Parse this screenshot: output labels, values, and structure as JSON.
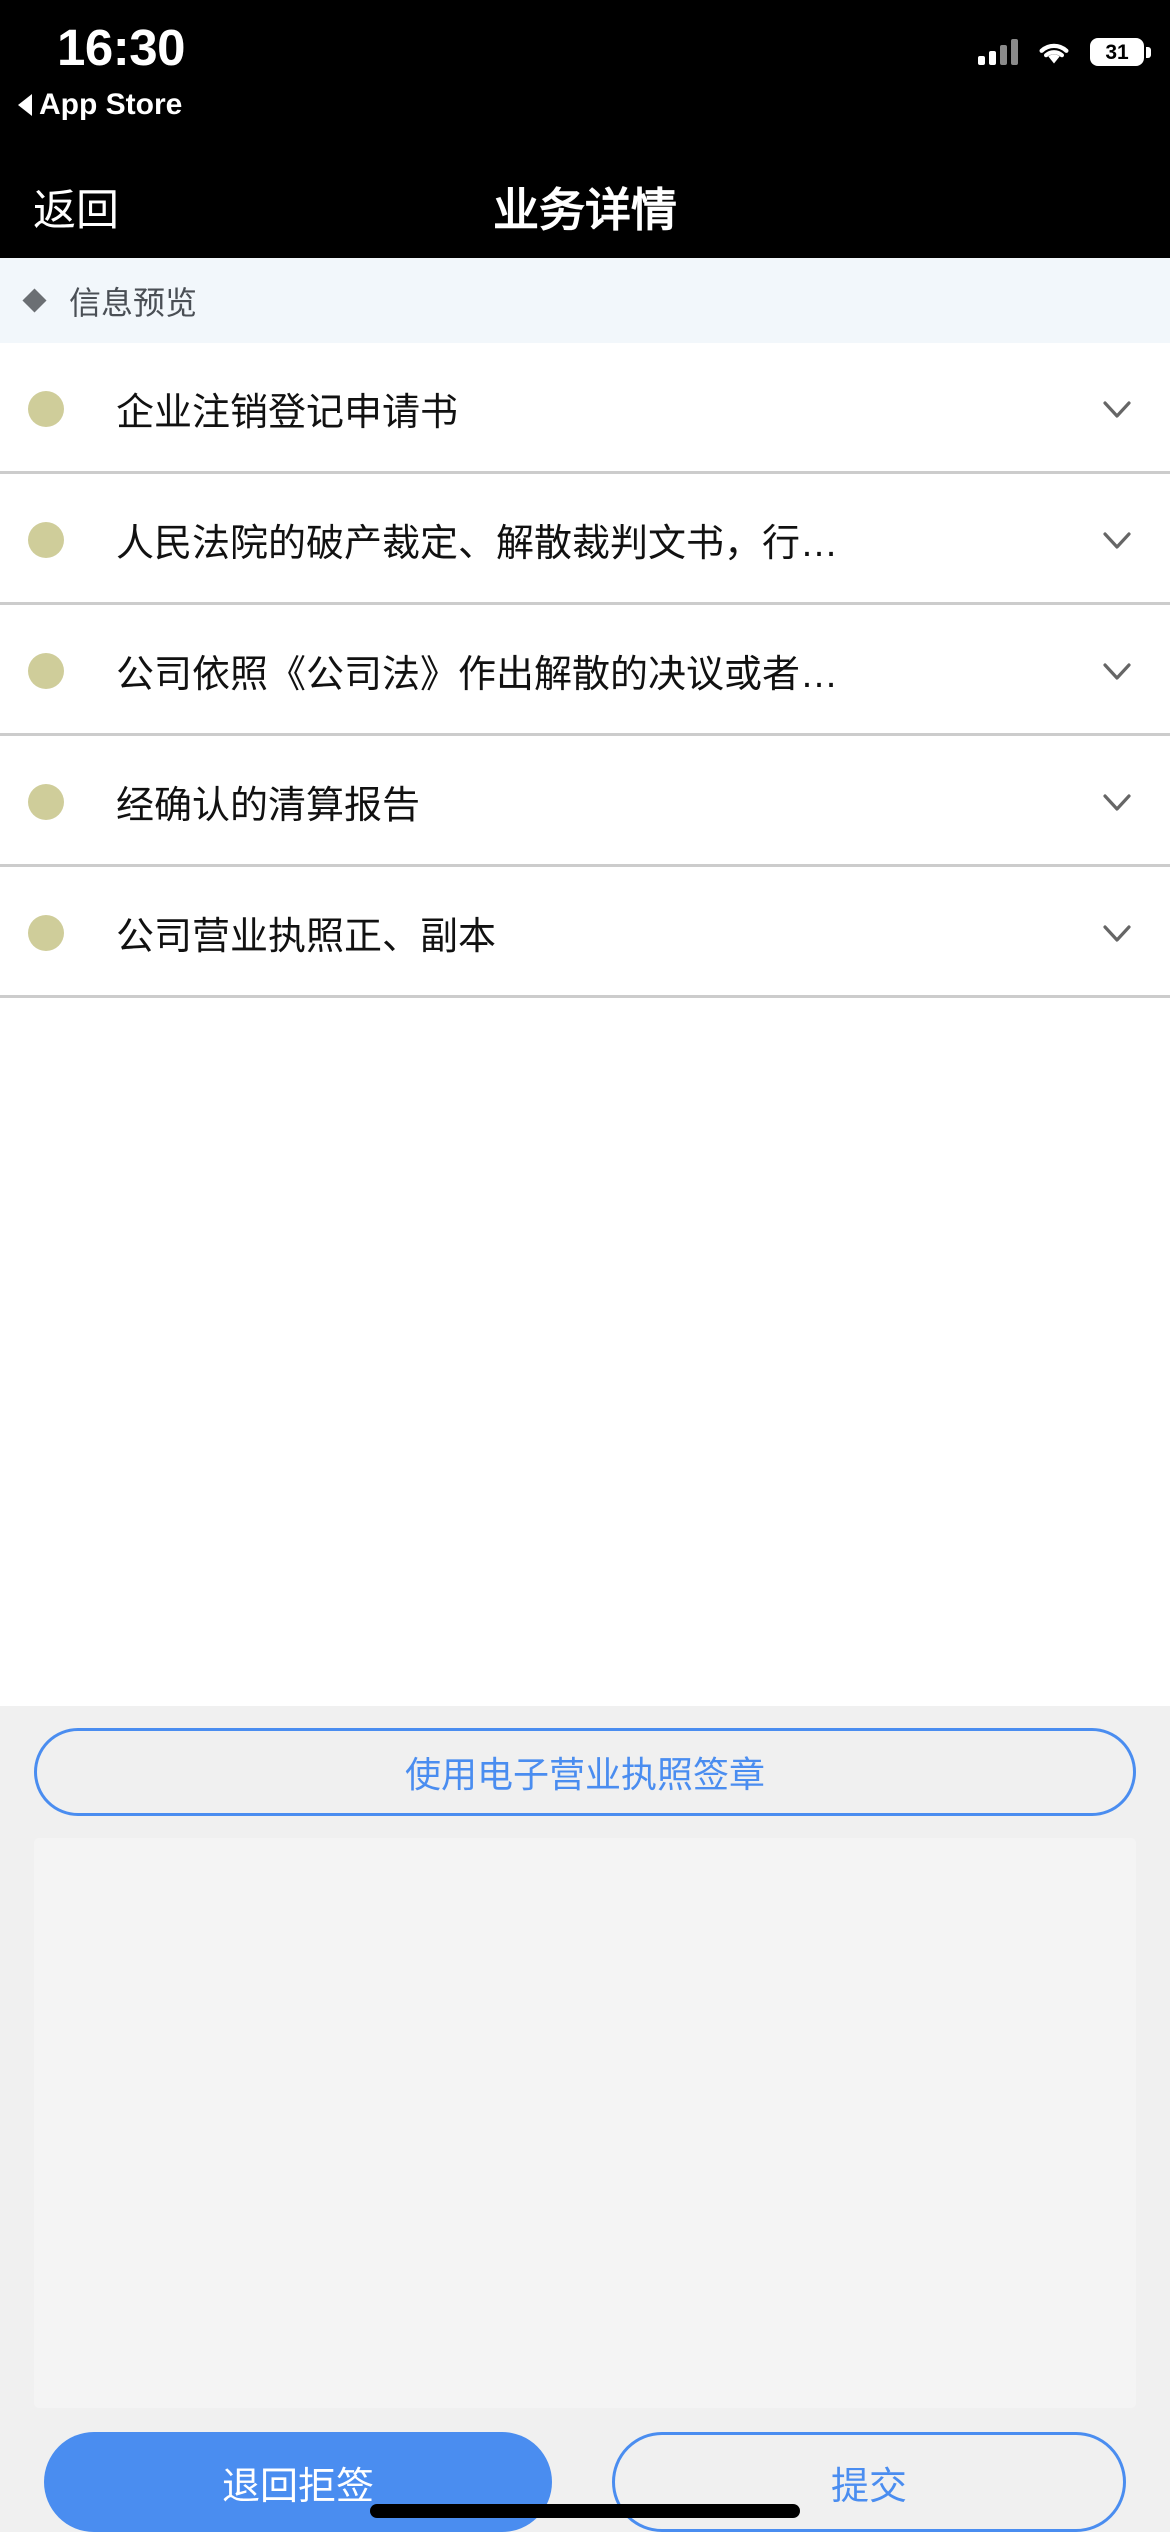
{
  "status_bar": {
    "time": "16:30",
    "back_to_app": "App Store",
    "battery_level": "31",
    "icons": {
      "back_triangle": "triangle-left-icon",
      "cellular": "cellular-bars-icon",
      "wifi": "wifi-icon",
      "battery": "battery-icon"
    }
  },
  "nav_bar": {
    "back_label": "返回",
    "title": "业务详情"
  },
  "section": {
    "bullet_icon": "diamond-bullet-icon",
    "title": "信息预览"
  },
  "list": {
    "items": [
      {
        "label": "企业注销登记申请书",
        "bullet_icon": "status-dot-icon",
        "chevron_icon": "chevron-down-icon"
      },
      {
        "label": "人民法院的破产裁定、解散裁判文书，行…",
        "bullet_icon": "status-dot-icon",
        "chevron_icon": "chevron-down-icon"
      },
      {
        "label": "公司依照《公司法》作出解散的决议或者…",
        "bullet_icon": "status-dot-icon",
        "chevron_icon": "chevron-down-icon"
      },
      {
        "label": "经确认的清算报告",
        "bullet_icon": "status-dot-icon",
        "chevron_icon": "chevron-down-icon"
      },
      {
        "label": "公司营业执照正、副本",
        "bullet_icon": "status-dot-icon",
        "chevron_icon": "chevron-down-icon"
      }
    ]
  },
  "bottom": {
    "seal_button_label": "使用电子营业执照签章",
    "signature_area_value": "",
    "reject_button_label": "退回拒签",
    "submit_button_label": "提交"
  },
  "colors": {
    "accent_blue": "#4a8df0",
    "bullet_khaki": "#cfcd9a",
    "section_band": "#f2f7fb",
    "panel_gray": "#f0f0f0",
    "signature_gray": "#f4f4f4",
    "divider": "#cccccc"
  }
}
